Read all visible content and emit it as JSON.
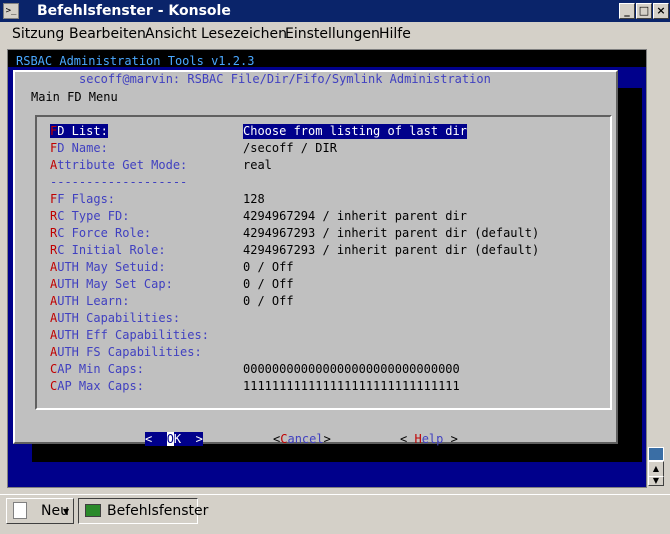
{
  "window": {
    "title": "Befehlsfenster - Konsole"
  },
  "menu": [
    "Sitzung",
    "Bearbeiten",
    "Ansicht",
    "Lesezeichen",
    "Einstellungen",
    "Hilfe"
  ],
  "terminal": {
    "header": "RSBAC Administration Tools v1.2.3",
    "dialog_title": "secoff@marvin: RSBAC File/Dir/Fifo/Symlink Administration",
    "menu_title": "Main FD Menu",
    "rows": [
      {
        "hk": "F",
        "rest": "D List:",
        "value": "Choose from listing of last dir"
      },
      {
        "hk": "F",
        "rest": "D Name:",
        "value": "/secoff / DIR"
      },
      {
        "hk": "A",
        "rest": "ttribute Get Mode:",
        "value": "real"
      },
      {
        "hk": "",
        "rest": "-------------------",
        "value": ""
      },
      {
        "hk": "F",
        "rest": "F Flags:",
        "value": "128"
      },
      {
        "hk": "R",
        "rest": "C Type FD:",
        "value": "4294967294 / inherit parent dir"
      },
      {
        "hk": "R",
        "rest": "C Force Role:",
        "value": "4294967293 / inherit parent dir (default)"
      },
      {
        "hk": "R",
        "rest": "C Initial Role:",
        "value": "4294967293 / inherit parent dir (default)"
      },
      {
        "hk": "A",
        "rest": "UTH May Setuid:",
        "value": "0 / Off"
      },
      {
        "hk": "A",
        "rest": "UTH May Set Cap:",
        "value": "0 / Off"
      },
      {
        "hk": "A",
        "rest": "UTH Learn:",
        "value": "0 / Off"
      },
      {
        "hk": "A",
        "rest": "UTH Capabilities:",
        "value": ""
      },
      {
        "hk": "A",
        "rest": "UTH Eff Capabilities:",
        "value": ""
      },
      {
        "hk": "A",
        "rest": "UTH FS Capabilities:",
        "value": ""
      },
      {
        "hk": "C",
        "rest": "AP Min Caps:",
        "value": "000000000000000000000000000000"
      },
      {
        "hk": "C",
        "rest": "AP Max Caps:",
        "value": "111111111111111111111111111111"
      }
    ],
    "buttons": {
      "ok": {
        "left": "<  ",
        "hk": "O",
        "rest": "K",
        "right": "  >"
      },
      "cancel": {
        "left": "<",
        "hk": "C",
        "rest": "ancel",
        "right": ">"
      },
      "help": {
        "left": "< ",
        "hk": "H",
        "rest": "elp",
        "right": " >"
      }
    }
  },
  "taskbar": {
    "new_label": "Neu",
    "session_label": "Befehlsfenster"
  }
}
